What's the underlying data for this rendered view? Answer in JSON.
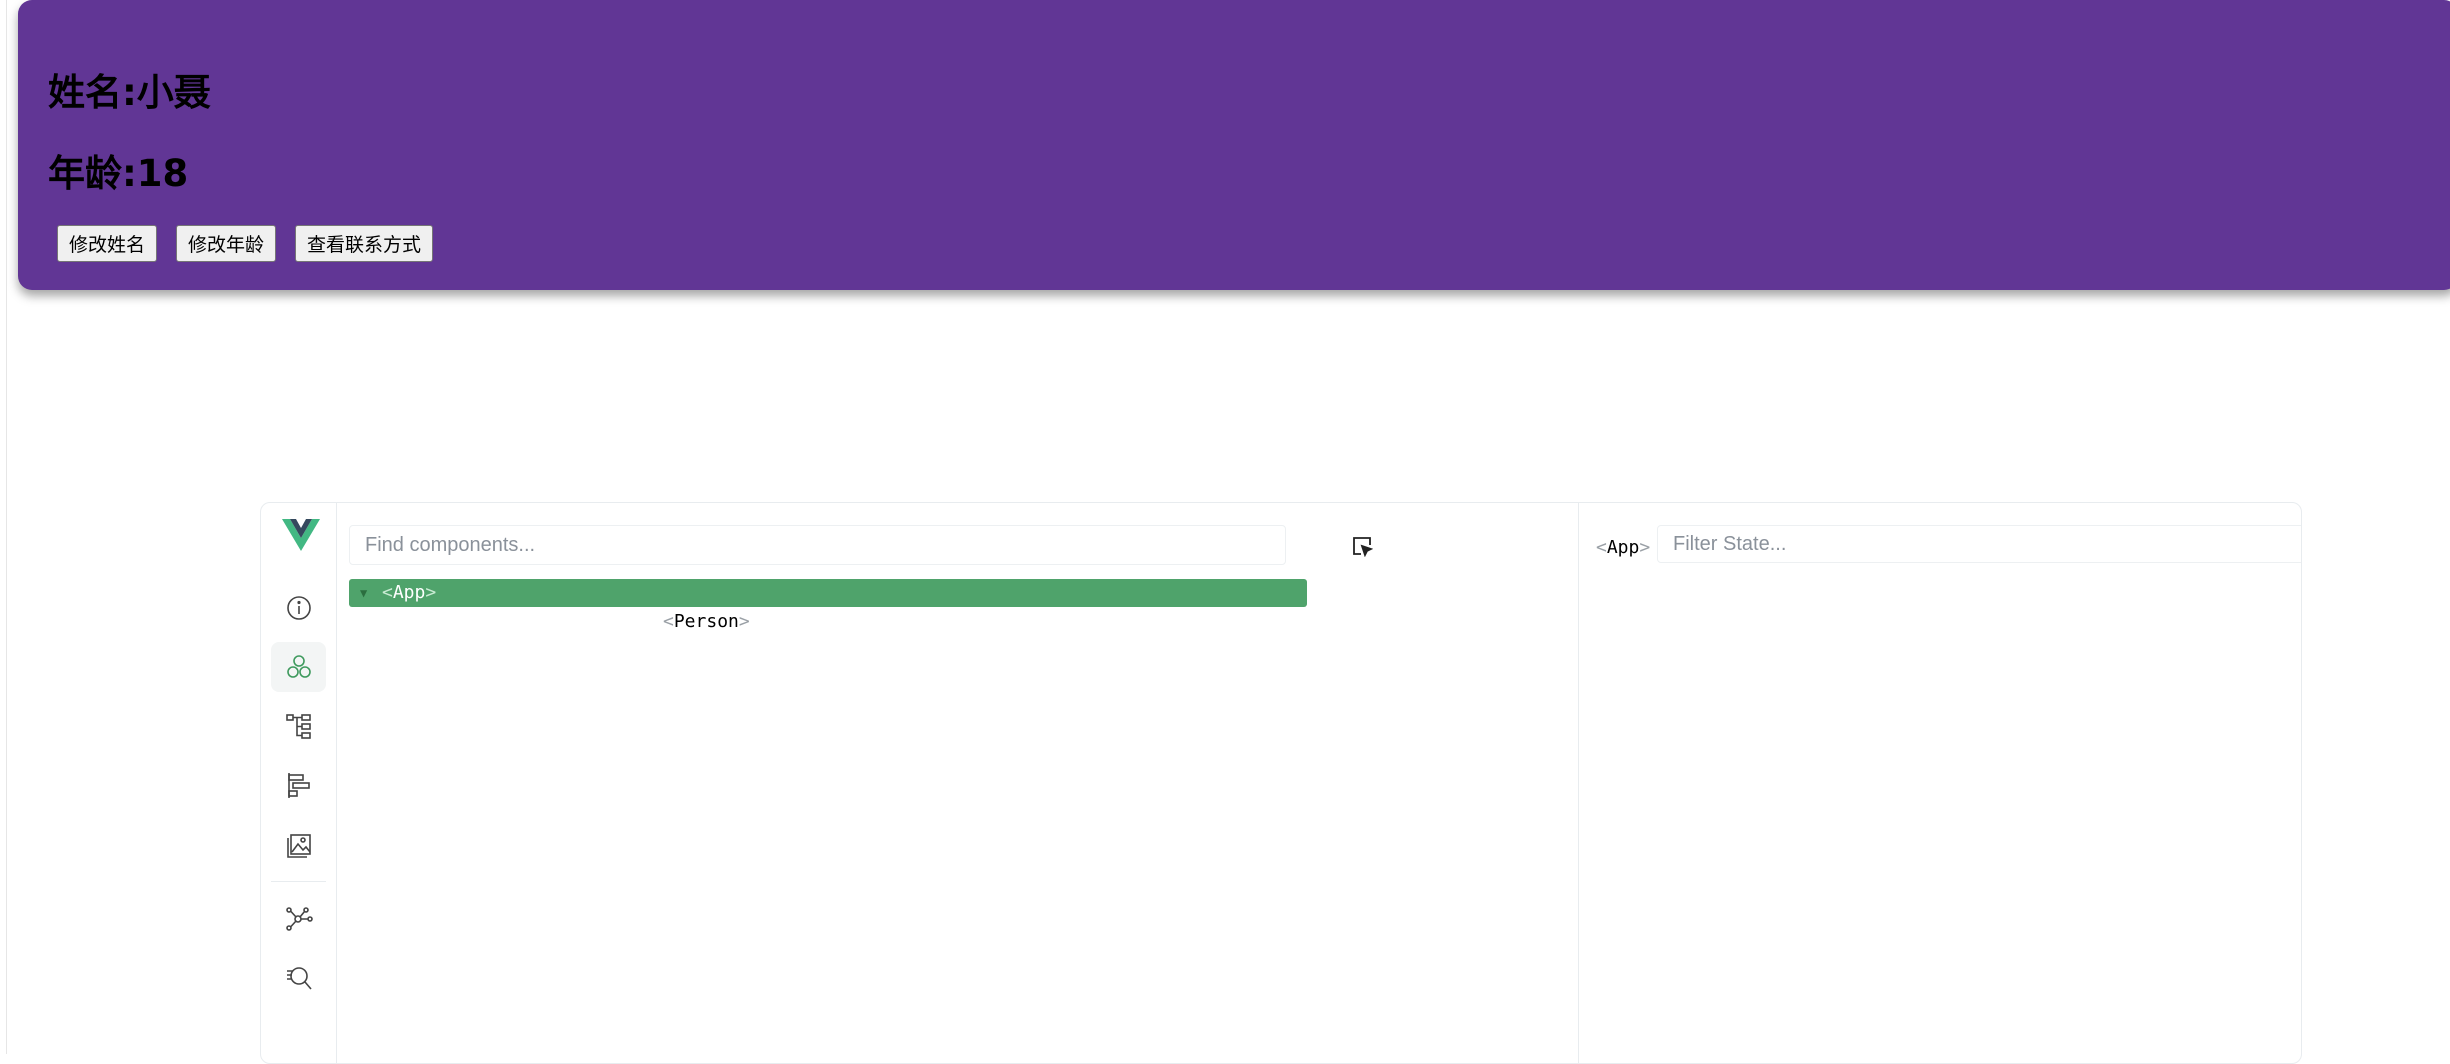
{
  "person": {
    "name_line": "姓名:小聂",
    "age_line": "年龄:18",
    "buttons": {
      "change_name": "修改姓名",
      "change_age": "修改年龄",
      "view_contact": "查看联系方式"
    },
    "card_color": "#613695"
  },
  "devtools": {
    "find_placeholder": "Find components...",
    "filter_placeholder": "Filter State...",
    "tree": {
      "app": {
        "open": "<",
        "name": "App",
        "close": ">"
      },
      "person": {
        "open": "<",
        "name": "Person",
        "close": ">"
      }
    },
    "selected_component": {
      "open": "<",
      "name": "App",
      "close": ">"
    },
    "accent_color": "#4fa36b",
    "sidebar_icons": [
      "info-icon",
      "components-icon",
      "component-tree-icon",
      "timeline-icon",
      "assets-icon",
      "graph-icon",
      "search-inspect-icon"
    ],
    "toolbar_icons": [
      "scroll-to-component-icon",
      "open-in-editor-icon",
      "external-link-icon"
    ]
  }
}
